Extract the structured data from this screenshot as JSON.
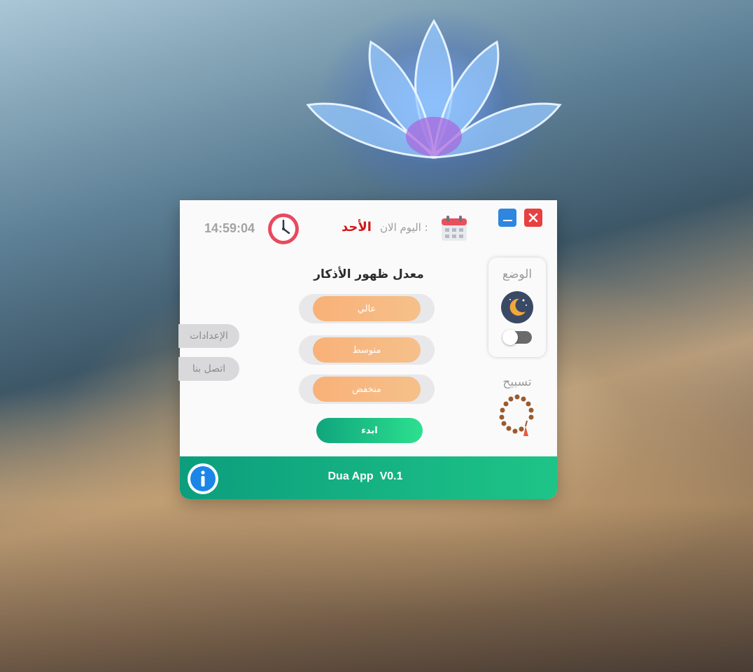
{
  "header": {
    "time": "14:59:04",
    "day_name": "الأحد",
    "day_label": "اليوم الان :",
    "icons": [
      "clock-icon",
      "calendar-icon"
    ]
  },
  "window_controls": {
    "icons": [
      "minimize-icon",
      "close-icon"
    ]
  },
  "rate_section": {
    "title": "معدل ظهور الأذكار",
    "levels": [
      "عالي",
      "متوسط",
      "منخفض"
    ],
    "start_label": "ابدء"
  },
  "mode_card": {
    "label": "الوضع",
    "icon": "moon-icon",
    "toggle_on": false
  },
  "tasbih": {
    "label": "تسبيح",
    "icon": "prayer-beads-icon"
  },
  "side_menu": {
    "items": [
      "الإعدادات",
      "اتصل بنا"
    ]
  },
  "footer": {
    "title": "Dua App  V0.1",
    "icon": "info-icon"
  },
  "colors": {
    "accent_green": "#1ec487",
    "level_orange": "#f8b178",
    "day_red": "#d01616",
    "close_red": "#e74040",
    "minimize_blue": "#2e86de"
  }
}
